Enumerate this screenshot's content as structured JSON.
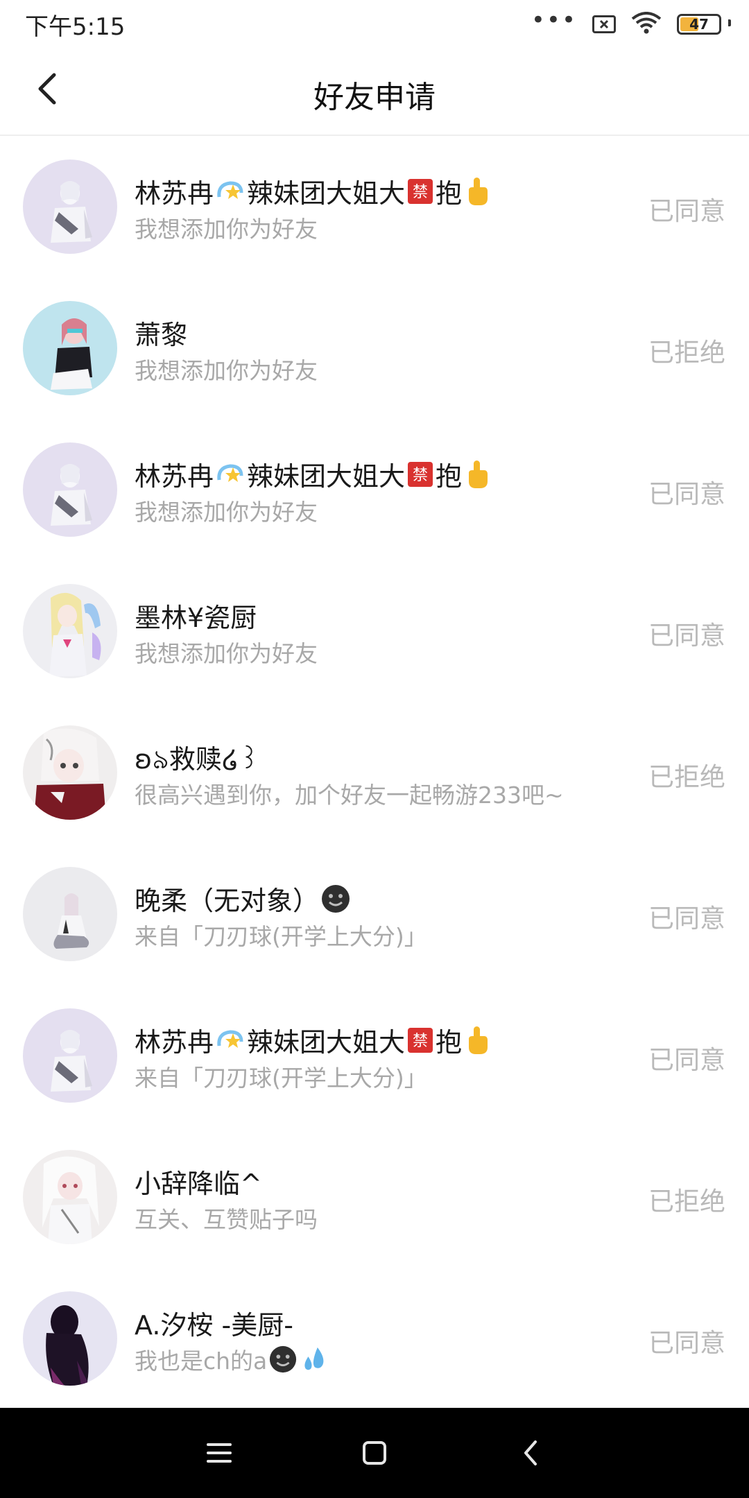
{
  "status_bar": {
    "time": "下午5:15",
    "dots": "•••",
    "battery_level": "47"
  },
  "header": {
    "title": "好友申请",
    "back_icon": "chevron-left-icon"
  },
  "colors": {
    "status_text": "#b9b9b9",
    "secondary_text": "#a8a8a8",
    "divider": "#eeeeee",
    "nav_bg": "#000000"
  },
  "requests": [
    {
      "name": "林苏冉",
      "name_tail_a": "辣妹团大姐大",
      "name_tail_b": "抱",
      "emoji_icons": [
        "dizzy-star-icon",
        "forbidden-sign-icon",
        "pointing-hand-icon"
      ],
      "message": "我想添加你为好友",
      "status": "已同意",
      "avatar": "anime-girl-white-avatar"
    },
    {
      "name": "萧黎",
      "message": "我想添加你为好友",
      "status": "已拒绝",
      "avatar": "anime-girl-pink-avatar"
    },
    {
      "name": "林苏冉",
      "name_tail_a": "辣妹团大姐大",
      "name_tail_b": "抱",
      "emoji_icons": [
        "dizzy-star-icon",
        "forbidden-sign-icon",
        "pointing-hand-icon"
      ],
      "message": "我想添加你为好友",
      "status": "已同意",
      "avatar": "anime-girl-white-avatar"
    },
    {
      "name": "墨林¥瓷厨",
      "message": "我想添加你为好友",
      "status": "已同意",
      "avatar": "anime-girl-blonde-avatar"
    },
    {
      "name": "ʚ৯救赎໒꒱",
      "message": "很高兴遇到你，加个好友一起畅游233吧~",
      "status": "已拒绝",
      "avatar": "anime-girl-dark-avatar"
    },
    {
      "name": "晚柔（无对象）",
      "emoji_icons": [
        "black-smiley-icon"
      ],
      "message": "来自「刀刃球(开学上大分)」",
      "status": "已同意",
      "avatar": "anime-girl-sitting-avatar"
    },
    {
      "name": "林苏冉",
      "name_tail_a": "辣妹团大姐大",
      "name_tail_b": "抱",
      "emoji_icons": [
        "dizzy-star-icon",
        "forbidden-sign-icon",
        "pointing-hand-icon"
      ],
      "message": "来自「刀刃球(开学上大分)」",
      "status": "已同意",
      "avatar": "anime-girl-white-avatar"
    },
    {
      "name": "小辞降临^",
      "message": "互关、互赞贴子吗",
      "status": "已拒绝",
      "avatar": "anime-girl-silver-avatar"
    },
    {
      "name": "A.汐桉 -美厨-",
      "message": "我也是ch的a",
      "message_icons": [
        "black-smiley-icon",
        "sweat-drops-icon"
      ],
      "status": "已同意",
      "avatar": "anime-silhouette-avatar"
    }
  ],
  "nav": {
    "menu_icon": "menu-icon",
    "home_icon": "home-square-icon",
    "back_icon": "back-triangle-icon"
  }
}
